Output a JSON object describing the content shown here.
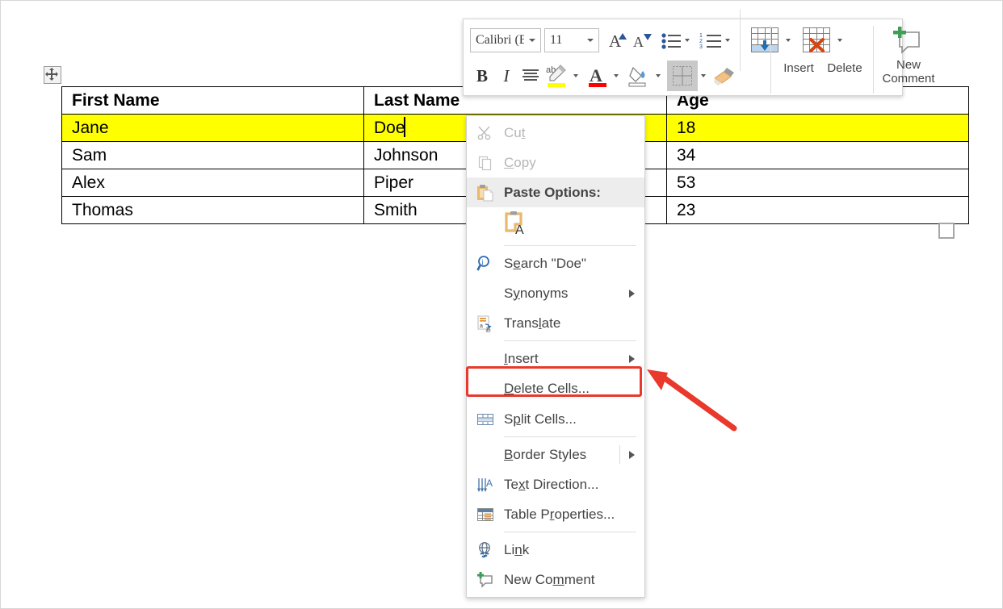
{
  "document": {
    "table": {
      "columns": [
        "First Name",
        "Last Name",
        "Age"
      ],
      "rows": [
        {
          "first": "Jane",
          "last": "Doe",
          "age": "18",
          "highlighted": true
        },
        {
          "first": "Sam",
          "last": "Johnson",
          "age": "34",
          "highlighted": false
        },
        {
          "first": "Alex",
          "last": "Piper",
          "age": "53",
          "highlighted": false
        },
        {
          "first": "Thomas",
          "last": "Smith",
          "age": "23",
          "highlighted": false
        }
      ],
      "highlight_color": "#ffff00"
    },
    "move_handle_icon": "move-cross-icon",
    "resize_handle_icon": "resize-square-icon"
  },
  "mini_toolbar": {
    "font_name": "Calibri (B",
    "font_size": "11",
    "grow_font_label": "A",
    "shrink_font_label": "A",
    "bold_label": "B",
    "italic_label": "I",
    "insert_label": "Insert",
    "delete_label": "Delete",
    "new_comment_label": "New\nComment",
    "new_comment_line1": "New",
    "new_comment_line2": "Comment",
    "icons": [
      "bullets-icon",
      "numbering-icon",
      "align-icon",
      "text-highlight-icon",
      "font-color-icon",
      "shading-icon",
      "borders-icon",
      "format-painter-icon",
      "insert-table-rows-icon",
      "delete-table-icon",
      "new-comment-icon"
    ],
    "highlight_color": "#ffff00",
    "font_color": "#ff0000"
  },
  "context_menu": {
    "items": [
      {
        "label": "Cut",
        "icon": "scissors-icon",
        "disabled": true,
        "underline_index": 2
      },
      {
        "label": "Copy",
        "icon": "copy-icon",
        "disabled": true,
        "underline_index": 0
      },
      {
        "label": "Paste Options:",
        "icon": "paste-icon",
        "heading": true
      },
      {
        "label": "Search \"Doe\"",
        "icon": "search-icon",
        "underline_index": 1
      },
      {
        "label": "Synonyms",
        "icon": "",
        "submenu": true,
        "underline_index": 1
      },
      {
        "label": "Translate",
        "icon": "translate-icon",
        "underline_index": 5
      },
      {
        "label": "Insert",
        "icon": "",
        "submenu": true,
        "underline_index": 0
      },
      {
        "label": "Delete Cells...",
        "icon": "",
        "highlighted_box": true,
        "underline_index": 0
      },
      {
        "label": "Split Cells...",
        "icon": "split-cells-icon",
        "underline_index": 1
      },
      {
        "label": "Border Styles",
        "icon": "",
        "submenu": true,
        "underline_index": 0
      },
      {
        "label": "Text Direction...",
        "icon": "text-direction-icon",
        "underline_index": 2
      },
      {
        "label": "Table Properties...",
        "icon": "table-properties-icon",
        "underline_index": 7
      },
      {
        "label": "Link",
        "icon": "link-icon",
        "underline_index": 2
      },
      {
        "label": "New Comment",
        "icon": "new-comment-icon",
        "underline_index": 6
      }
    ],
    "paste_option_icon": "paste-keep-text-only-icon"
  },
  "annotation": {
    "highlight_box_color": "#e8392c",
    "arrow_color": "#e8392c",
    "arrow_points_to": "Delete Cells..."
  }
}
